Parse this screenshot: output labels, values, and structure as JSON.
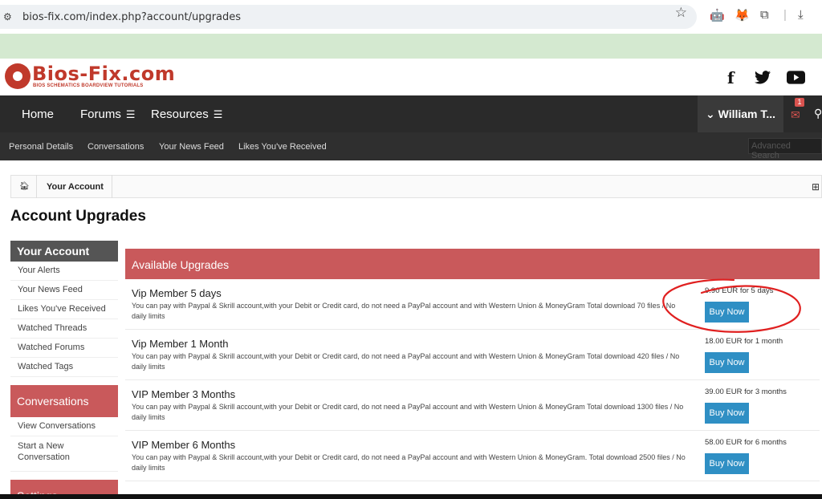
{
  "browser": {
    "url": "bios-fix.com/index.php?account/upgrades",
    "icons": [
      "tune-icon",
      "star-icon",
      "robot-icon",
      "fox-icon",
      "puzzle-icon",
      "download-icon"
    ]
  },
  "site": {
    "logo_main": "Bios-Fix.com",
    "logo_sub": "BIOS SCHEMATICS BOARDVIEW TUTORIALS",
    "social": [
      "f",
      "twitter",
      "youtube"
    ]
  },
  "nav": {
    "items": [
      "Home",
      "Forums",
      "Resources"
    ],
    "user": "William T...",
    "mail_count": "1"
  },
  "subnav": {
    "items": [
      "Personal Details",
      "Conversations",
      "Your News Feed",
      "Likes You've Received"
    ],
    "search_placeholder": "Advanced Search"
  },
  "breadcrumb": {
    "label": "Your Account"
  },
  "page_title": "Account Upgrades",
  "sidebar": {
    "sections": [
      {
        "title": "Your Account",
        "links": [
          "Your Alerts",
          "Your News Feed",
          "Likes You've Received",
          "Watched Threads",
          "Watched Forums",
          "Watched Tags"
        ]
      },
      {
        "title": "Conversations",
        "links": [
          "View Conversations",
          "Start a New Conversation"
        ]
      },
      {
        "title": "Settings"
      }
    ]
  },
  "upgrades": {
    "heading": "Available Upgrades",
    "buy_label": "Buy Now",
    "items": [
      {
        "title": "Vip Member 5 days",
        "desc": "You can pay with Paypal & Skrill account,with your Debit or Credit card, do not need a PayPal account and with Western Union & MoneyGram Total download 70 files / No daily limits",
        "price": "9.90 EUR for 5 days"
      },
      {
        "title": "Vip Member 1 Month",
        "desc": "You can pay with Paypal & Skrill account,with your Debit or Credit card, do not need a PayPal account and with Western Union & MoneyGram Total download 420 files / No daily limits",
        "price": "18.00 EUR for 1 month"
      },
      {
        "title": "VIP Member 3 Months",
        "desc": "You can pay with Paypal & Skrill account,with your Debit or Credit card, do not need a PayPal account and with Western Union & MoneyGram Total download 1300 files / No daily limits",
        "price": "39.00 EUR for 3 months"
      },
      {
        "title": "VIP Member 6 Months",
        "desc": "You can pay with Paypal & Skrill account,with your Debit or Credit card, do not need a PayPal account and with Western Union & MoneyGram. Total download 2500 files / No daily limits",
        "price": "58.00 EUR for 6 months"
      }
    ]
  },
  "annotation_color": "#e02020"
}
